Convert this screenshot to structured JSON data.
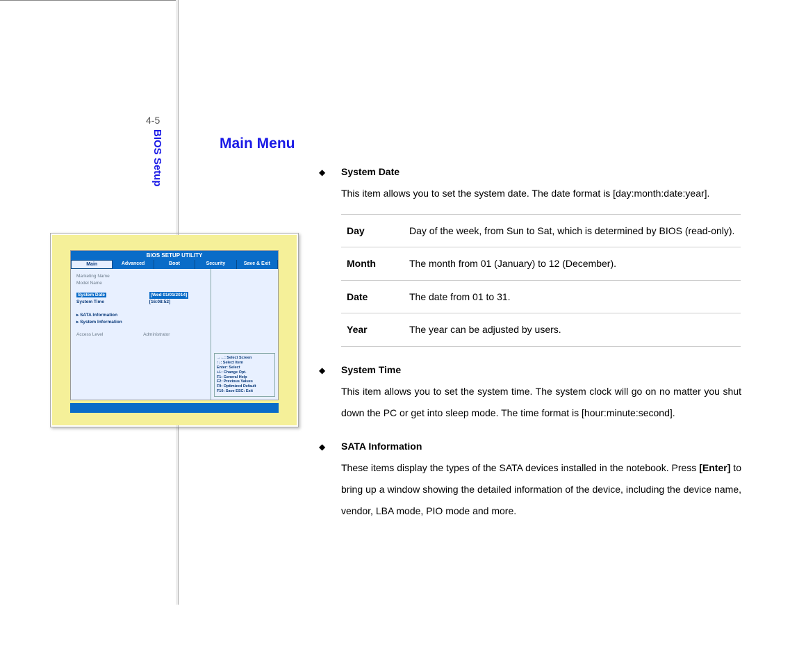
{
  "page_number": "4-5",
  "sidebar_label": "BIOS Setup",
  "main_title": "Main Menu",
  "sections": [
    {
      "title": "System Date",
      "body": "This item allows you to set the system date.  The date format is [day:month:date:year]."
    },
    {
      "title": "System Time",
      "body": "This item allows you to set the system time.  The system clock will go on no matter you shut down the PC or get into sleep mode.  The time format is [hour:minute:second]."
    },
    {
      "title": "SATA Information",
      "body_pre": "These items display the types of the SATA devices installed in the notebook. Press ",
      "body_key": "[Enter]",
      "body_post": " to bring up a window showing the detailed information of the device, including the device name, vendor, LBA mode, PIO mode and more."
    }
  ],
  "definitions": [
    {
      "term": "Day",
      "desc": "Day of the week, from Sun to Sat, which is determined by BIOS (read-only)."
    },
    {
      "term": "Month",
      "desc": "The month from 01 (January) to 12 (December)."
    },
    {
      "term": "Date",
      "desc": "The date from 01 to 31."
    },
    {
      "term": "Year",
      "desc": "The year can be adjusted by users."
    }
  ],
  "bios_screenshot": {
    "title": "BIOS SETUP UTILITY",
    "tabs": [
      "Main",
      "Advanced",
      "Boot",
      "Security",
      "Save & Exit"
    ],
    "active_tab": "Main",
    "left_items": {
      "marketing": "Marketing Name",
      "model": "Model Name",
      "sys_date_label": "System Date",
      "sys_date_val": "[Wed 01/01/2014]",
      "sys_time_label": "System Time",
      "sys_time_val": "[16:08:52]",
      "sata": "SATA Information",
      "sysinfo": "System Information",
      "access_label": "Access Level",
      "access_val": "Administrator"
    },
    "help_lines": [
      "→←: Select Screen",
      "↑↓: Select Item",
      "Enter: Select",
      "+/-: Change Opt.",
      "F1: General Help",
      "F2: Previous Values",
      "F9: Optimized Default",
      "F10: Save  ESC: Exit"
    ]
  }
}
